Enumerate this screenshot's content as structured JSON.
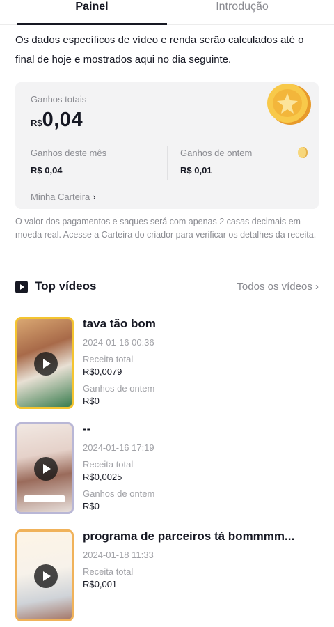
{
  "tabs": [
    {
      "label": "Painel",
      "active": true
    },
    {
      "label": "Introdução",
      "active": false
    }
  ],
  "notice": "Os dados específicos de vídeo e renda serão calculados até o final de hoje e mostrados aqui no dia seguinte.",
  "earnings": {
    "total_label": "Ganhos totais",
    "currency": "R$",
    "total_value": "0,04",
    "month_label": "Ganhos deste mês",
    "month_value": "R$ 0,04",
    "yesterday_label": "Ganhos de ontem",
    "yesterday_value": "R$ 0,01",
    "wallet_label": "Minha Carteira"
  },
  "disclaimer": "O valor dos pagamentos e saques será com apenas 2 casas decimais em moeda real. Acesse a Carteira do criador para verificar os detalhes da receita.",
  "top_videos": {
    "title": "Top vídeos",
    "all_link": "Todos os vídeos",
    "items": [
      {
        "title": "tava tão bom",
        "date": "2024-01-16 00:36",
        "revenue_label": "Receita total",
        "revenue": "R$0,0079",
        "yesterday_label": "Ganhos de ontem",
        "yesterday": "R$0"
      },
      {
        "title": "--",
        "date": "2024-01-16 17:19",
        "revenue_label": "Receita total",
        "revenue": "R$0,0025",
        "yesterday_label": "Ganhos de ontem",
        "yesterday": "R$0"
      },
      {
        "title": "programa de parceiros tá bommmm...",
        "date": "2024-01-18 11:33",
        "revenue_label": "Receita total",
        "revenue": "R$0,001"
      }
    ]
  },
  "colors": {
    "accent_gold": "#f4c430",
    "muted_text": "#8a8b91",
    "card_bg": "#f3f3f4"
  }
}
